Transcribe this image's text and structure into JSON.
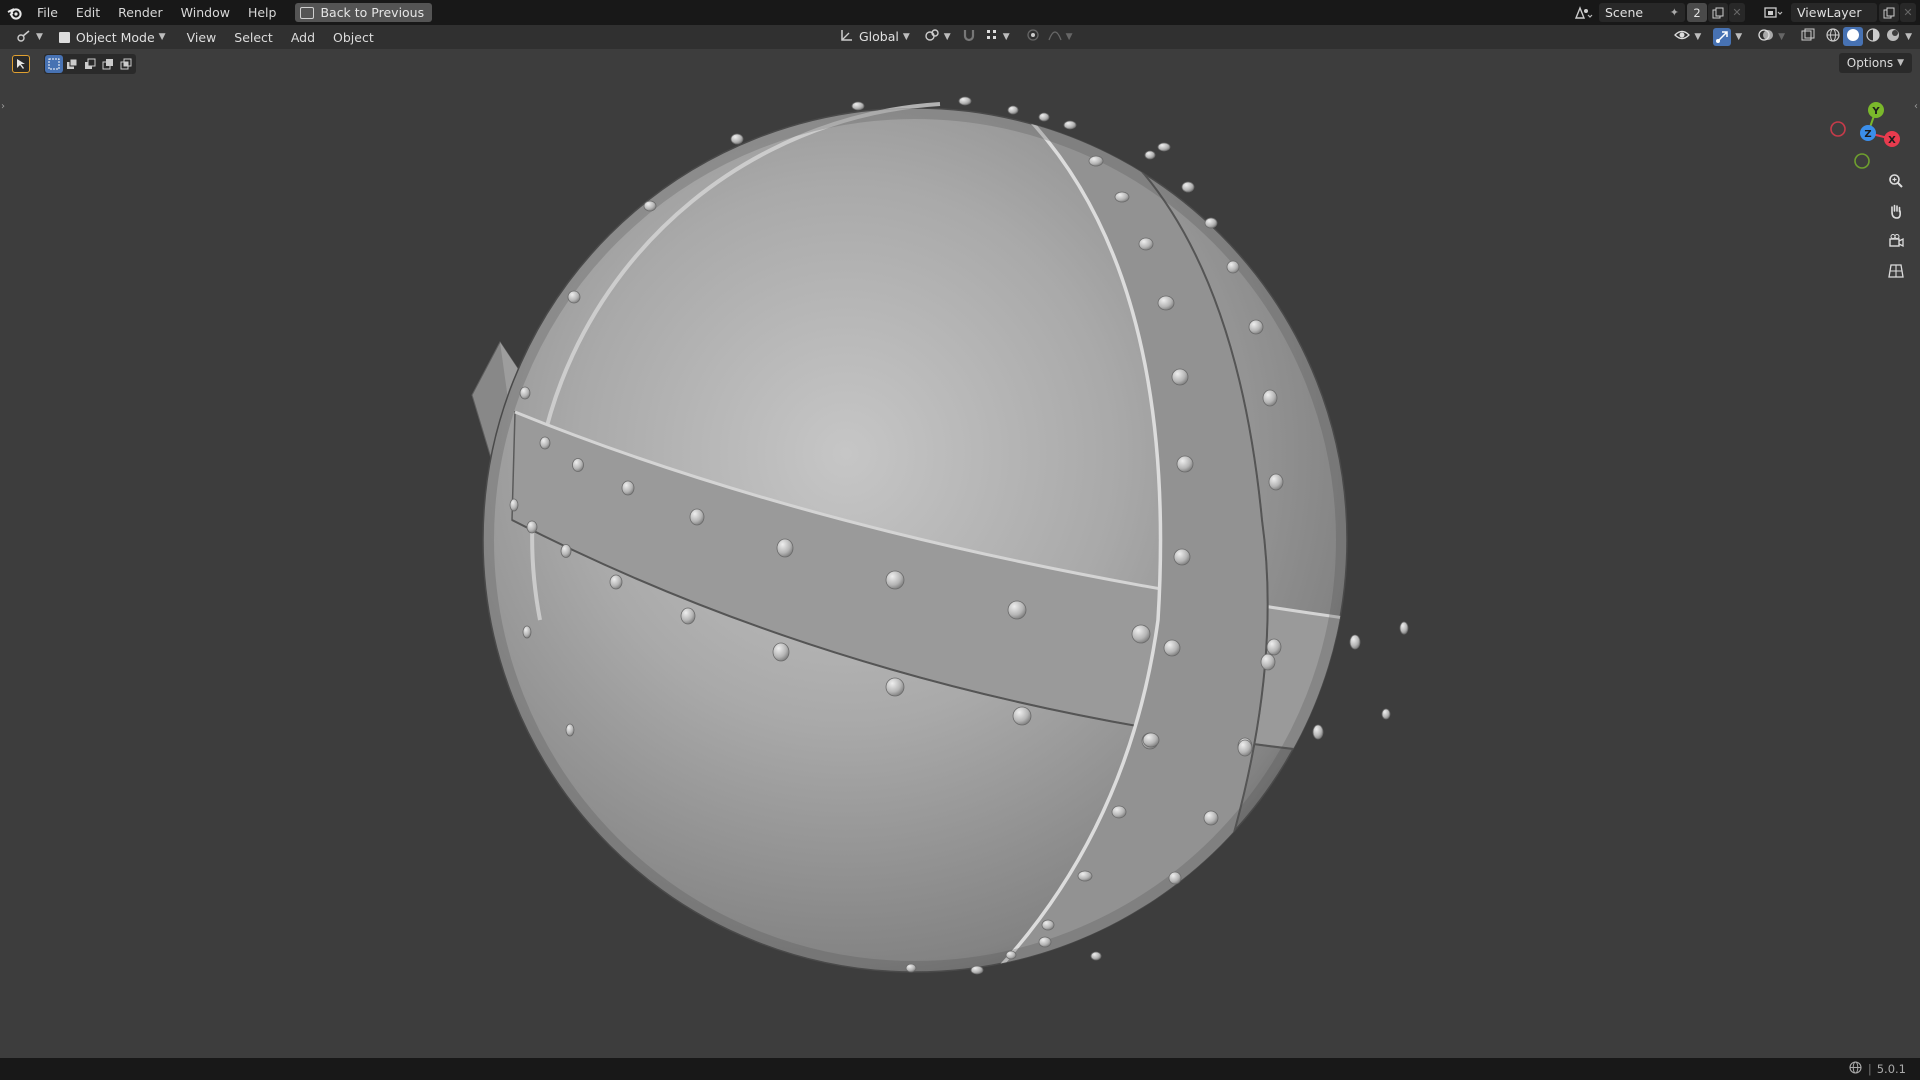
{
  "menu": {
    "file": "File",
    "edit": "Edit",
    "render": "Render",
    "window": "Window",
    "help": "Help",
    "back_to_previous": "Back to Previous"
  },
  "top_right": {
    "scene": "Scene",
    "scene_users": "2",
    "view_layer": "ViewLayer"
  },
  "viewport_header": {
    "mode": "Object Mode",
    "view": "View",
    "select": "Select",
    "add": "Add",
    "object": "Object",
    "transform_orientation": "Global"
  },
  "options_label": "Options",
  "gizmo": {
    "x": "X",
    "y": "Y",
    "z": "Z"
  },
  "status": {
    "version": "5.0.1"
  },
  "colors": {
    "accent_blue": "#4772b3",
    "axis_x": "#e83b4e",
    "axis_y": "#7ab82b",
    "axis_z": "#3b8eea"
  },
  "icons": [
    "blender-logo-icon",
    "back-icon",
    "scene-icon",
    "pin-icon",
    "new-scene-icon",
    "close-icon",
    "view-layer-icon",
    "editor-type-icon",
    "object-mode-icon",
    "orientation-icon",
    "pivot-icon",
    "snap-icon",
    "grid-snap-icon",
    "proportional-icon",
    "falloff-icon",
    "visibility-icon",
    "gizmo-icon",
    "overlay-icon",
    "xray-icon",
    "wireframe-shading-icon",
    "solid-shading-icon",
    "material-shading-icon",
    "rendered-shading-icon",
    "zoom-icon",
    "pan-hand-icon",
    "camera-icon",
    "ortho-grid-icon",
    "globe-icon"
  ]
}
